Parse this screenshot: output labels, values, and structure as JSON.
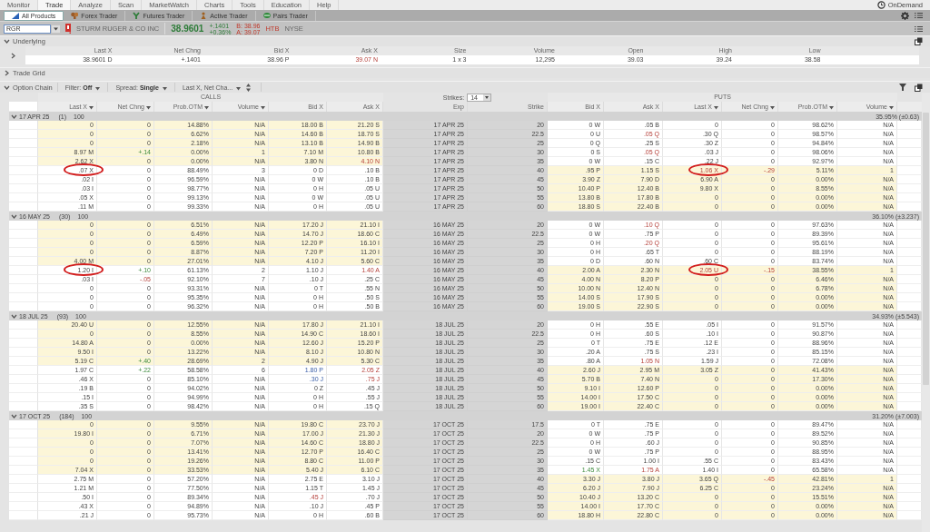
{
  "menu": {
    "items": [
      {
        "label": "Monitor",
        "selected": false
      },
      {
        "label": "Trade",
        "selected": true
      },
      {
        "label": "Analyze",
        "selected": false
      },
      {
        "label": "Scan",
        "selected": false
      },
      {
        "label": "MarketWatch",
        "selected": false
      },
      {
        "label": "Charts",
        "selected": false
      },
      {
        "label": "Tools",
        "selected": false
      },
      {
        "label": "Education",
        "selected": false
      },
      {
        "label": "Help",
        "selected": false
      }
    ],
    "ondemand": "OnDemand"
  },
  "products": [
    {
      "label": "All Products",
      "selected": true
    },
    {
      "label": "Forex Trader",
      "selected": false
    },
    {
      "label": "Futures Trader",
      "selected": false
    },
    {
      "label": "Active Trader",
      "selected": false
    },
    {
      "label": "Pairs Trader",
      "selected": false
    }
  ],
  "quote": {
    "symbol": "RGR",
    "company": "STURM RUGER & CO INC",
    "last": "38.9601",
    "change": "+.1401",
    "change_pct": "+0.36%",
    "bid": "B: 38.96",
    "ask": "A: 39.07",
    "htb": "HTB",
    "exchange": "NYSE"
  },
  "underlying": {
    "title": "Underlying",
    "expanded": true,
    "columns": [
      "Last X",
      "Net Chng",
      "Bid X",
      "Ask X",
      "Size",
      "Volume",
      "Open",
      "High",
      "Low"
    ],
    "values": [
      "38.9601 D",
      "+.1401",
      "38.96 P",
      {
        "text": "39.07 N",
        "down": true
      },
      "1 x 3",
      "12,295",
      "39.03",
      "39.24",
      "38.58"
    ]
  },
  "trade_grid": {
    "title": "Trade Grid",
    "expanded": false
  },
  "option_chain": {
    "title": "Option Chain",
    "expanded": true,
    "filter": "Filter: **Off**",
    "spread": "Spread: **Single**",
    "layout": "Last X, Net Cha...",
    "calls_label": "CALLS",
    "puts_label": "PUTS",
    "strikes_label": "Strikes:",
    "strikes": "14",
    "call_columns": [
      {
        "label": "Last X",
        "menu": true
      },
      {
        "label": "Net Chng",
        "menu": true
      },
      {
        "label": "Prob.OTM",
        "menu": true
      },
      {
        "label": "Volume",
        "menu": true
      },
      {
        "label": "Bid X",
        "menu": false
      },
      {
        "label": "Ask X",
        "menu": false
      }
    ],
    "center_columns": [
      {
        "label": "Exp",
        "menu": false
      },
      {
        "label": "Strike",
        "menu": false
      }
    ],
    "put_columns": [
      {
        "label": "Bid X",
        "menu": false
      },
      {
        "label": "Ask X",
        "menu": false
      },
      {
        "label": "Last X",
        "menu": true
      },
      {
        "label": "Net Chng",
        "menu": true
      },
      {
        "label": "Prob.OTM",
        "menu": true
      },
      {
        "label": "Volume",
        "menu": true
      }
    ],
    "groups": [
      {
        "expiration": "17 APR 25",
        "days": "(1)",
        "multiplier": "100",
        "iv": "35.95% (±0.63)",
        "expanded": true,
        "rows": [
          {
            "call_itm": true,
            "put_itm": false,
            "calls": [
              "0",
              "0",
              "14.88%",
              "N/A",
              "18.00 B",
              "21.20 S"
            ],
            "exp": "17 APR 25",
            "strike": "20",
            "puts": [
              "0 W",
              ".05 B",
              "0",
              "0",
              "98.62%",
              "N/A"
            ]
          },
          {
            "call_itm": true,
            "put_itm": false,
            "calls": [
              "0",
              "0",
              "6.62%",
              "N/A",
              "14.60 B",
              "18.70 S"
            ],
            "exp": "17 APR 25",
            "strike": "22.5",
            "puts": [
              "0 U",
              {
                "text": ".05 Q",
                "down": true
              },
              ".30 Q",
              "0",
              "98.57%",
              "N/A"
            ]
          },
          {
            "call_itm": true,
            "put_itm": false,
            "calls": [
              "0",
              "0",
              "2.18%",
              "N/A",
              "13.10 B",
              "14.90 B"
            ],
            "exp": "17 APR 25",
            "strike": "25",
            "puts": [
              "0 Q",
              ".25 S",
              ".30 Z",
              "0",
              "94.84%",
              "N/A"
            ]
          },
          {
            "call_itm": true,
            "put_itm": false,
            "calls": [
              "8.97 M",
              {
                "text": "+.14",
                "up": true
              },
              "0.00%",
              "1",
              "7.10 M",
              "10.80 B"
            ],
            "exp": "17 APR 25",
            "strike": "30",
            "puts": [
              "0 S",
              {
                "text": ".05 Q",
                "down": true
              },
              ".03 J",
              "0",
              "98.06%",
              "N/A"
            ]
          },
          {
            "call_itm": true,
            "put_itm": false,
            "calls": [
              "2.62 X",
              "0",
              "0.00%",
              "N/A",
              "3.80 N",
              {
                "text": "4.10 N",
                "down": true
              }
            ],
            "exp": "17 APR 25",
            "strike": "35",
            "puts": [
              "0 W",
              ".15 C",
              ".22 J",
              "0",
              "92.97%",
              "N/A"
            ]
          },
          {
            "call_itm": false,
            "put_itm": true,
            "calls": [
              {
                "text": ".07 X",
                "circled": true
              },
              "0",
              "88.49%",
              "3",
              "0 D",
              ".10 B"
            ],
            "exp": "17 APR 25",
            "strike": "40",
            "puts": [
              ".95 P",
              "1.15 S",
              {
                "text": "1.06 X",
                "down": true,
                "circled": true
              },
              {
                "text": "-.29",
                "down": true
              },
              "5.11%",
              "1"
            ]
          },
          {
            "call_itm": false,
            "put_itm": true,
            "calls": [
              ".02 I",
              "0",
              "96.59%",
              "N/A",
              "0 W",
              ".10 B"
            ],
            "exp": "17 APR 25",
            "strike": "45",
            "puts": [
              "3.90 Z",
              "7.90 D",
              "6.90 A",
              "0",
              "0.00%",
              "N/A"
            ]
          },
          {
            "call_itm": false,
            "put_itm": true,
            "calls": [
              ".03 I",
              "0",
              "98.77%",
              "N/A",
              "0 H",
              ".05 U"
            ],
            "exp": "17 APR 25",
            "strike": "50",
            "puts": [
              "10.40 P",
              "12.40 B",
              "9.80 X",
              "0",
              "8.55%",
              "N/A"
            ]
          },
          {
            "call_itm": false,
            "put_itm": true,
            "calls": [
              ".05 X",
              "0",
              "99.13%",
              "N/A",
              "0 W",
              ".05 U"
            ],
            "exp": "17 APR 25",
            "strike": "55",
            "puts": [
              "13.80 B",
              "17.80 B",
              "0",
              "0",
              "0.00%",
              "N/A"
            ]
          },
          {
            "call_itm": false,
            "put_itm": true,
            "calls": [
              ".11 M",
              "0",
              "99.33%",
              "N/A",
              "0 H",
              ".05 U"
            ],
            "exp": "17 APR 25",
            "strike": "60",
            "puts": [
              "18.80 S",
              "22.40 B",
              "0",
              "0",
              "0.00%",
              "N/A"
            ]
          }
        ]
      },
      {
        "expiration": "16 MAY 25",
        "days": "(30)",
        "multiplier": "100",
        "iv": "36.10% (±3.237)",
        "expanded": true,
        "rows": [
          {
            "call_itm": true,
            "put_itm": false,
            "calls": [
              "0",
              "0",
              "6.51%",
              "N/A",
              "17.20 J",
              "21.10 I"
            ],
            "exp": "16 MAY 25",
            "strike": "20",
            "puts": [
              "0 W",
              {
                "text": ".10 Q",
                "down": true
              },
              "0",
              "0",
              "97.63%",
              "N/A"
            ]
          },
          {
            "call_itm": true,
            "put_itm": false,
            "calls": [
              "0",
              "0",
              "6.49%",
              "N/A",
              "14.70 J",
              "18.60 C"
            ],
            "exp": "16 MAY 25",
            "strike": "22.5",
            "puts": [
              "0 W",
              ".75 P",
              "0",
              "0",
              "89.39%",
              "N/A"
            ]
          },
          {
            "call_itm": true,
            "put_itm": false,
            "calls": [
              "0",
              "0",
              "6.59%",
              "N/A",
              "12.20 P",
              "16.10 I"
            ],
            "exp": "16 MAY 25",
            "strike": "25",
            "puts": [
              "0 H",
              {
                "text": ".20 Q",
                "down": true
              },
              "0",
              "0",
              "95.61%",
              "N/A"
            ]
          },
          {
            "call_itm": true,
            "put_itm": false,
            "calls": [
              "0",
              "0",
              "8.87%",
              "N/A",
              "7.20 P",
              "11.20 I"
            ],
            "exp": "16 MAY 25",
            "strike": "30",
            "puts": [
              "0 H",
              ".65 T",
              "0",
              "0",
              "88.19%",
              "N/A"
            ]
          },
          {
            "call_itm": true,
            "put_itm": false,
            "calls": [
              "4.00 M",
              "0",
              "27.01%",
              "N/A",
              "4.10 J",
              "5.60 C"
            ],
            "exp": "16 MAY 25",
            "strike": "35",
            "puts": [
              "0 D",
              ".60 N",
              ".60 C",
              "0",
              "83.74%",
              "N/A"
            ]
          },
          {
            "call_itm": false,
            "put_itm": true,
            "calls": [
              {
                "text": "1.20 I",
                "circled": true
              },
              {
                "text": "+.10",
                "up": true
              },
              "61.13%",
              "2",
              "1.10 J",
              {
                "text": "1.40 A",
                "down": true
              }
            ],
            "exp": "16 MAY 25",
            "strike": "40",
            "puts": [
              "2.00 A",
              "2.30 N",
              {
                "text": "2.05 U",
                "down": true,
                "circled": true
              },
              {
                "text": "-.15",
                "down": true
              },
              "38.55%",
              "1"
            ]
          },
          {
            "call_itm": false,
            "put_itm": true,
            "calls": [
              ".03 I",
              {
                "text": "-.05",
                "down": true
              },
              "92.10%",
              "7",
              ".10 J",
              ".25 C"
            ],
            "exp": "16 MAY 25",
            "strike": "45",
            "puts": [
              "4.00 N",
              "8.20 P",
              "0",
              "0",
              "6.46%",
              "N/A"
            ]
          },
          {
            "call_itm": false,
            "put_itm": true,
            "calls": [
              "0",
              "0",
              "93.31%",
              "N/A",
              "0 T",
              ".55 N"
            ],
            "exp": "16 MAY 25",
            "strike": "50",
            "puts": [
              "10.00 N",
              "12.40 N",
              "0",
              "0",
              "6.78%",
              "N/A"
            ]
          },
          {
            "call_itm": false,
            "put_itm": true,
            "calls": [
              "0",
              "0",
              "95.35%",
              "N/A",
              "0 H",
              ".50 S"
            ],
            "exp": "16 MAY 25",
            "strike": "55",
            "puts": [
              "14.00 S",
              "17.90 S",
              "0",
              "0",
              "0.00%",
              "N/A"
            ]
          },
          {
            "call_itm": false,
            "put_itm": true,
            "calls": [
              "0",
              "0",
              "96.32%",
              "N/A",
              "0 H",
              ".50 B"
            ],
            "exp": "16 MAY 25",
            "strike": "60",
            "puts": [
              "19.00 S",
              "22.90 S",
              "0",
              "0",
              "0.00%",
              "N/A"
            ]
          }
        ]
      },
      {
        "expiration": "18 JUL 25",
        "days": "(93)",
        "multiplier": "100",
        "iv": "34.93% (±5.543)",
        "expanded": true,
        "rows": [
          {
            "call_itm": true,
            "put_itm": false,
            "calls": [
              "20.40 U",
              "0",
              "12.55%",
              "N/A",
              "17.80 J",
              "21.10 I"
            ],
            "exp": "18 JUL 25",
            "strike": "20",
            "puts": [
              "0 H",
              ".55 E",
              ".05 I",
              "0",
              "91.57%",
              "N/A"
            ]
          },
          {
            "call_itm": true,
            "put_itm": false,
            "calls": [
              "0",
              "0",
              "8.55%",
              "N/A",
              "14.90 C",
              "18.60 I"
            ],
            "exp": "18 JUL 25",
            "strike": "22.5",
            "puts": [
              "0 H",
              ".60 S",
              ".10 I",
              "0",
              "90.87%",
              "N/A"
            ]
          },
          {
            "call_itm": true,
            "put_itm": false,
            "calls": [
              "14.80 A",
              "0",
              "0.00%",
              "N/A",
              "12.60 J",
              "15.20 P"
            ],
            "exp": "18 JUL 25",
            "strike": "25",
            "puts": [
              "0 T",
              ".75 E",
              ".12 E",
              "0",
              "88.96%",
              "N/A"
            ]
          },
          {
            "call_itm": true,
            "put_itm": false,
            "calls": [
              "9.50 I",
              "0",
              "13.22%",
              "N/A",
              "8.10 J",
              "10.80 N"
            ],
            "exp": "18 JUL 25",
            "strike": "30",
            "puts": [
              ".20 A",
              ".75 S",
              ".23 I",
              "0",
              "85.15%",
              "N/A"
            ]
          },
          {
            "call_itm": true,
            "put_itm": false,
            "calls": [
              "5.19 C",
              {
                "text": "+.40",
                "up": true
              },
              "28.69%",
              "2",
              "4.90 J",
              "5.30 C"
            ],
            "exp": "18 JUL 25",
            "strike": "35",
            "puts": [
              ".80 A",
              {
                "text": "1.05 N",
                "down": true
              },
              "1.59 J",
              "0",
              "72.08%",
              "N/A"
            ]
          },
          {
            "call_itm": false,
            "put_itm": true,
            "calls": [
              "1.97 C",
              {
                "text": "+.22",
                "up": true
              },
              "58.58%",
              "6",
              {
                "text": "1.80 P",
                "marked": true
              },
              {
                "text": "2.05 Z",
                "down": true
              }
            ],
            "exp": "18 JUL 25",
            "strike": "40",
            "puts": [
              "2.60 J",
              "2.95 M",
              "3.05 Z",
              "0",
              "41.43%",
              "N/A"
            ]
          },
          {
            "call_itm": false,
            "put_itm": true,
            "calls": [
              ".46 X",
              "0",
              "85.10%",
              "N/A",
              {
                "text": ".30 J",
                "marked": true
              },
              {
                "text": ".75 J",
                "down": true
              }
            ],
            "exp": "18 JUL 25",
            "strike": "45",
            "puts": [
              "5.70 B",
              "7.40 N",
              "0",
              "0",
              "17.30%",
              "N/A"
            ]
          },
          {
            "call_itm": false,
            "put_itm": true,
            "calls": [
              ".19 B",
              "0",
              "94.02%",
              "N/A",
              "0 Z",
              ".45 J"
            ],
            "exp": "18 JUL 25",
            "strike": "50",
            "puts": [
              "9.10 I",
              "12.60 P",
              "0",
              "0",
              "0.00%",
              "N/A"
            ]
          },
          {
            "call_itm": false,
            "put_itm": true,
            "calls": [
              ".15 I",
              "0",
              "94.99%",
              "N/A",
              "0 H",
              ".55 J"
            ],
            "exp": "18 JUL 25",
            "strike": "55",
            "puts": [
              "14.00 I",
              "17.50 C",
              "0",
              "0",
              "0.00%",
              "N/A"
            ]
          },
          {
            "call_itm": false,
            "put_itm": true,
            "calls": [
              ".35 S",
              "0",
              "98.42%",
              "N/A",
              "0 H",
              ".15 Q"
            ],
            "exp": "18 JUL 25",
            "strike": "60",
            "puts": [
              "19.00 I",
              "22.40 C",
              "0",
              "0",
              "0.00%",
              "N/A"
            ]
          }
        ]
      },
      {
        "expiration": "17 OCT 25",
        "days": "(184)",
        "multiplier": "100",
        "iv": "31.20% (±7.003)",
        "expanded": true,
        "rows": [
          {
            "call_itm": true,
            "put_itm": false,
            "calls": [
              "0",
              "0",
              "9.55%",
              "N/A",
              "19.80 C",
              "23.70 J"
            ],
            "exp": "17 OCT 25",
            "strike": "17.5",
            "puts": [
              "0 T",
              ".75 E",
              "0",
              "0",
              "89.47%",
              "N/A"
            ]
          },
          {
            "call_itm": true,
            "put_itm": false,
            "calls": [
              "19.80 I",
              "0",
              "6.71%",
              "N/A",
              "17.00 J",
              "21.30 J"
            ],
            "exp": "17 OCT 25",
            "strike": "20",
            "puts": [
              "0 W",
              ".75 P",
              "0",
              "0",
              "89.52%",
              "N/A"
            ]
          },
          {
            "call_itm": true,
            "put_itm": false,
            "calls": [
              "0",
              "0",
              "7.07%",
              "N/A",
              "14.60 C",
              "18.80 J"
            ],
            "exp": "17 OCT 25",
            "strike": "22.5",
            "puts": [
              "0 H",
              ".60 J",
              "0",
              "0",
              "90.85%",
              "N/A"
            ]
          },
          {
            "call_itm": true,
            "put_itm": false,
            "calls": [
              "0",
              "0",
              "13.41%",
              "N/A",
              "12.70 P",
              "16.40 C"
            ],
            "exp": "17 OCT 25",
            "strike": "25",
            "puts": [
              "0 W",
              ".75 P",
              "0",
              "0",
              "88.95%",
              "N/A"
            ]
          },
          {
            "call_itm": true,
            "put_itm": false,
            "calls": [
              "0",
              "0",
              "19.26%",
              "N/A",
              "8.80 C",
              "11.00 P"
            ],
            "exp": "17 OCT 25",
            "strike": "30",
            "puts": [
              ".15 C",
              "1.00 I",
              ".55 C",
              "0",
              "83.43%",
              "N/A"
            ]
          },
          {
            "call_itm": true,
            "put_itm": false,
            "calls": [
              "7.04 X",
              "0",
              "33.53%",
              "N/A",
              "5.40 J",
              "6.10 C"
            ],
            "exp": "17 OCT 25",
            "strike": "35",
            "puts": [
              {
                "text": "1.45 X",
                "up": true
              },
              {
                "text": "1.75 A",
                "down": true
              },
              "1.40 I",
              "0",
              "65.58%",
              "N/A"
            ]
          },
          {
            "call_itm": false,
            "put_itm": true,
            "calls": [
              "2.75 M",
              "0",
              "57.20%",
              "N/A",
              "2.75 E",
              "3.10 J"
            ],
            "exp": "17 OCT 25",
            "strike": "40",
            "puts": [
              "3.30 J",
              "3.80 J",
              "3.65 Q",
              {
                "text": "-.45",
                "down": true
              },
              "42.81%",
              "1"
            ]
          },
          {
            "call_itm": false,
            "put_itm": true,
            "calls": [
              "1.21 M",
              "0",
              "77.50%",
              "N/A",
              "1.15 T",
              "1.45 J"
            ],
            "exp": "17 OCT 25",
            "strike": "45",
            "puts": [
              "6.20 J",
              "7.90 J",
              "6.25 C",
              "0",
              "23.24%",
              "N/A"
            ]
          },
          {
            "call_itm": false,
            "put_itm": true,
            "calls": [
              ".50 I",
              "0",
              "89.34%",
              "N/A",
              {
                "text": ".45 J",
                "down": true
              },
              ".70 J"
            ],
            "exp": "17 OCT 25",
            "strike": "50",
            "puts": [
              "10.40 J",
              "13.20 C",
              "0",
              "0",
              "15.51%",
              "N/A"
            ]
          },
          {
            "call_itm": false,
            "put_itm": true,
            "calls": [
              ".43 X",
              "0",
              "94.89%",
              "N/A",
              ".10 J",
              ".45 P"
            ],
            "exp": "17 OCT 25",
            "strike": "55",
            "puts": [
              "14.00 I",
              "17.70 C",
              "0",
              "0",
              "0.00%",
              "N/A"
            ]
          },
          {
            "call_itm": false,
            "put_itm": true,
            "calls": [
              ".21 J",
              "0",
              "95.73%",
              "N/A",
              "0 H",
              ".60 B"
            ],
            "exp": "17 OCT 25",
            "strike": "60",
            "puts": [
              "18.80 H",
              "22.80 C",
              "0",
              "0",
              "0.00%",
              "N/A"
            ]
          }
        ]
      }
    ]
  }
}
